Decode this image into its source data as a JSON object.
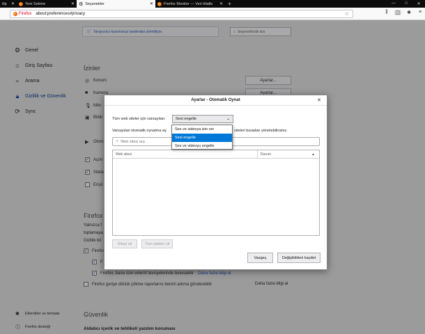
{
  "tabs": [
    {
      "label": "ilip",
      "active": false
    },
    {
      "label": "Yeni Sekme",
      "active": false
    },
    {
      "label": "Seçenekler",
      "active": true
    },
    {
      "label": "Firefox Monitor — Veri ihlalle",
      "active": false
    }
  ],
  "navbar": {
    "identity": "Firefox",
    "url": "about:preferences#privacy"
  },
  "prefs": {
    "top_link": "Tarayıcınız kurumunuz tarafından yönetiliyor.",
    "search_placeholder": "Seçeneklerde ara",
    "sidebar": [
      {
        "label": "Genel",
        "icon": "gear-icon"
      },
      {
        "label": "Giriş Sayfası",
        "icon": "home-icon"
      },
      {
        "label": "Arama",
        "icon": "search-icon"
      },
      {
        "label": "Gizlilik ve Güvenlik",
        "icon": "lock-icon",
        "selected": true
      },
      {
        "label": "Sync",
        "icon": "sync-icon"
      }
    ],
    "sidebar_footer": [
      {
        "label": "Eklentiler ve temalar",
        "icon": "puzzle-icon"
      },
      {
        "label": "Firefox desteği",
        "icon": "help-icon"
      }
    ],
    "permissions_heading": "İzinler",
    "perm_rows": [
      {
        "label": "Konum",
        "icon": "location-icon",
        "button": "Ayarlar..."
      },
      {
        "label": "Kamera",
        "icon": "camera-icon",
        "button": "Ayarlar..."
      },
      {
        "label": "Mikr",
        "icon": "microphone-icon"
      },
      {
        "label": "Bildir",
        "icon": "bell-icon"
      },
      {
        "label": "Otom",
        "icon": "autoplay-icon"
      }
    ],
    "checkbox_rows": [
      {
        "label": "Açılır",
        "checked": true
      },
      {
        "label": "Siteler",
        "checked": true
      },
      {
        "label": "Erişil",
        "checked": false
      }
    ],
    "firefox_heading": "Firefox",
    "firefox_text1": "Yalnızca f",
    "firefox_text2": "toplamaya",
    "firefox_link": "Gizlilik bil",
    "firefox_rows": [
      {
        "label": "Firefox",
        "checked": true
      },
      {
        "label": "F",
        "checked": true
      },
      {
        "label": "Firefox, bana özel eklenti tavsiyelerinde bulunabilir",
        "checked": true,
        "link": "Daha fazla bilgi al"
      },
      {
        "label": "Firefox geriye dönük çökme raporlarını benim adıma gönderebilir",
        "checked": false,
        "link": "Daha fazla bilgi al"
      }
    ],
    "security_heading": "Güvenlik",
    "security_sub": "Aldatıcı içerik ve tehlikeli yazılım koruması"
  },
  "dialog": {
    "title": "Ayarlar - Otomatik Oynat",
    "default_label": "Tüm web siteler için varsayılan:",
    "selected_value": "Sesi engelle",
    "description_left": "Varsayılan otomatik oynatma ay",
    "description_right": "siteleri buradan yönetebilirsiniz.",
    "search_placeholder": "Web sitesi ara",
    "columns": [
      "Web sitesi",
      "Durum"
    ],
    "remove_site": "Siteyi sil",
    "remove_all": "Tüm siteleri sil",
    "cancel": "Vazgeç",
    "save": "Değişiklikleri kaydet",
    "options": [
      {
        "label": "Ses ve videoya izin ver",
        "highlighted": false
      },
      {
        "label": "Sesi engelle",
        "highlighted": true
      },
      {
        "label": "Ses ve videoyu engelle",
        "highlighted": false
      }
    ]
  },
  "colors": {
    "accent": "#0078d7",
    "overlay": "#9b9b9b",
    "brand": "#e66000"
  }
}
